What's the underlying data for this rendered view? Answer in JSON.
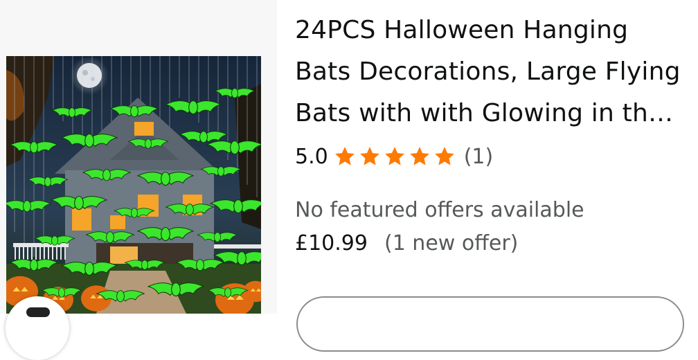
{
  "product": {
    "title": "24PCS Halloween Hanging Bats Decorations, Large Flying Bats with with Glowing in the Dark",
    "rating_value": "5.0",
    "rating_stars": 5,
    "review_count": "(1)",
    "offers_label": "No featured offers available",
    "price": "£10.99",
    "new_offer_text": "(1 new offer)"
  },
  "icons": {
    "star": "star-icon",
    "share": "share-icon"
  },
  "colors": {
    "star": "#ff7a00",
    "text": "#0f1111",
    "secondary_text": "#565959",
    "bat_green": "#3ce62d"
  }
}
